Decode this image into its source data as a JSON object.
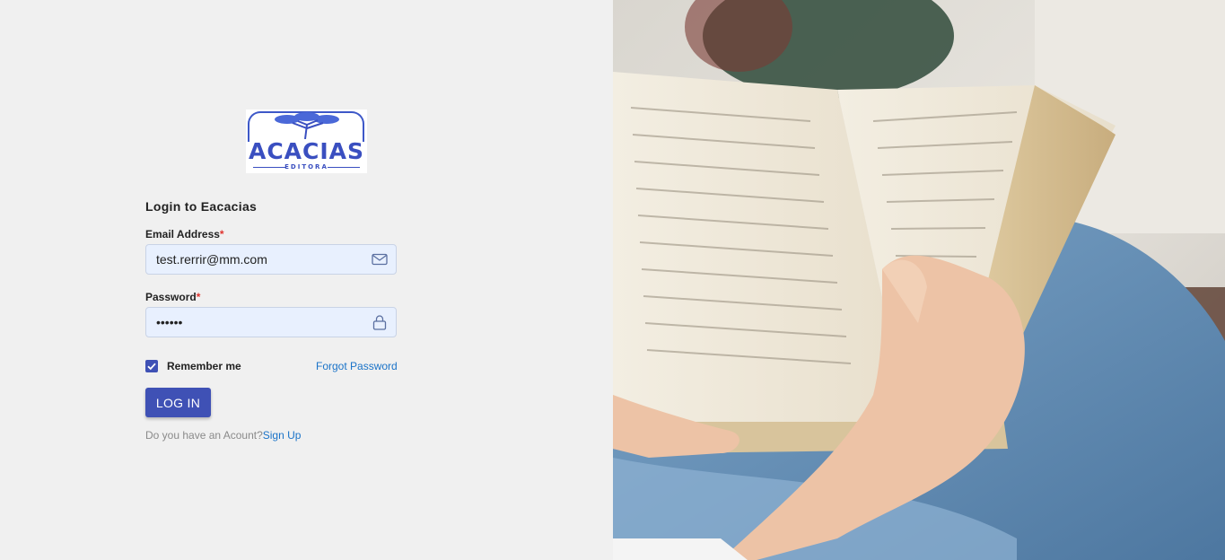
{
  "logo": {
    "brand": "ACACIAS",
    "sub": "EDITORA"
  },
  "form": {
    "title": "Login to Eacacias",
    "email": {
      "label": "Email Address",
      "required_mark": "*",
      "value": "test.rerrir@mm.com"
    },
    "password": {
      "label": "Password",
      "required_mark": "*",
      "value": "••••••"
    },
    "remember_label": "Remember me",
    "remember_checked": true,
    "forgot_label": "Forgot Password",
    "submit_label": "LOG IN",
    "signup_prompt": "Do you have an Acount?",
    "signup_link": "Sign Up"
  },
  "icons": {
    "email": "mail-icon",
    "password": "lock-icon",
    "check": "check-icon"
  },
  "colors": {
    "accent": "#3f51b5",
    "link": "#1a73c8",
    "required": "#e0342f",
    "field_bg": "#e8f0fe"
  }
}
